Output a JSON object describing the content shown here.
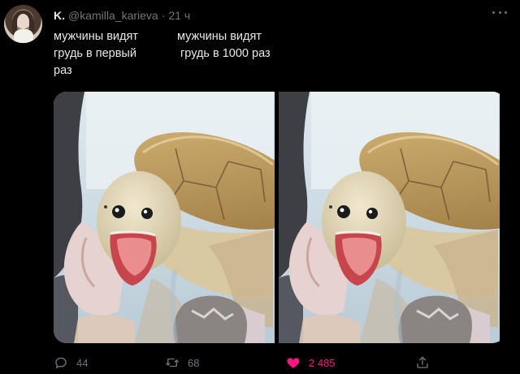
{
  "tweet": {
    "display_name": "K.",
    "handle": "@kamilla_karieva",
    "separator": "·",
    "time": "21 ч",
    "text_left": "мужчины видят\nгрудь в первый\nраз",
    "text_right_line1": "мужчины видят",
    "text_right_line2": "грудь в 1000 раз",
    "media": {
      "panels": [
        {
          "icon": "turtle-photo"
        },
        {
          "icon": "turtle-photo"
        }
      ]
    },
    "actions": {
      "reply_count": "44",
      "retweet_count": "68",
      "like_count": "2 485",
      "like_active": true,
      "like_color": "#f91880",
      "muted_color": "#71767b"
    }
  }
}
